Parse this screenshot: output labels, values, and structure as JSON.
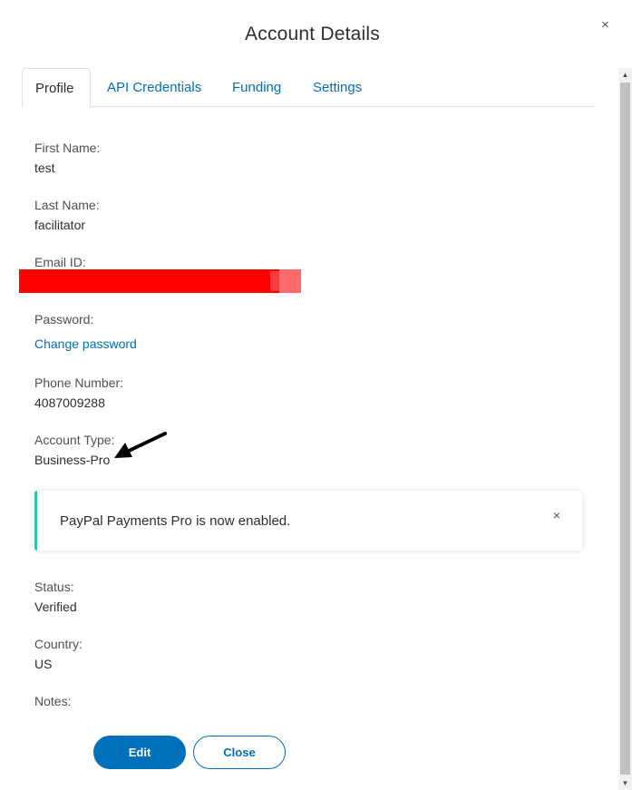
{
  "modal": {
    "title": "Account Details",
    "close_glyph": "×"
  },
  "tabs": [
    {
      "label": "Profile",
      "active": true
    },
    {
      "label": "API Credentials",
      "active": false
    },
    {
      "label": "Funding",
      "active": false
    },
    {
      "label": "Settings",
      "active": false
    }
  ],
  "profile": {
    "first_name": {
      "label": "First Name:",
      "value": "test"
    },
    "last_name": {
      "label": "Last Name:",
      "value": "facilitator"
    },
    "email": {
      "label": "Email ID:",
      "value_redacted": true,
      "redaction_color": "#ff0000"
    },
    "password": {
      "label": "Password:",
      "link": "Change password"
    },
    "phone": {
      "label": "Phone Number:",
      "value": "4087009288"
    },
    "account_type": {
      "label": "Account Type:",
      "value": "Business-Pro"
    },
    "status": {
      "label": "Status:",
      "value": "Verified"
    },
    "country": {
      "label": "Country:",
      "value": "US"
    },
    "notes": {
      "label": "Notes:"
    }
  },
  "alert": {
    "message": "PayPal Payments Pro is now enabled.",
    "close_glyph": "×",
    "accent_color": "#2ec4a5"
  },
  "buttons": {
    "edit": "Edit",
    "close": "Close"
  },
  "colors": {
    "accent": "#0070ba",
    "text": "#2c2e2f"
  },
  "icons": {
    "close": "close-icon",
    "arrow": "annotation-arrow-icon",
    "scroll_up": "scroll-up-icon",
    "scroll_down": "scroll-down-icon"
  }
}
